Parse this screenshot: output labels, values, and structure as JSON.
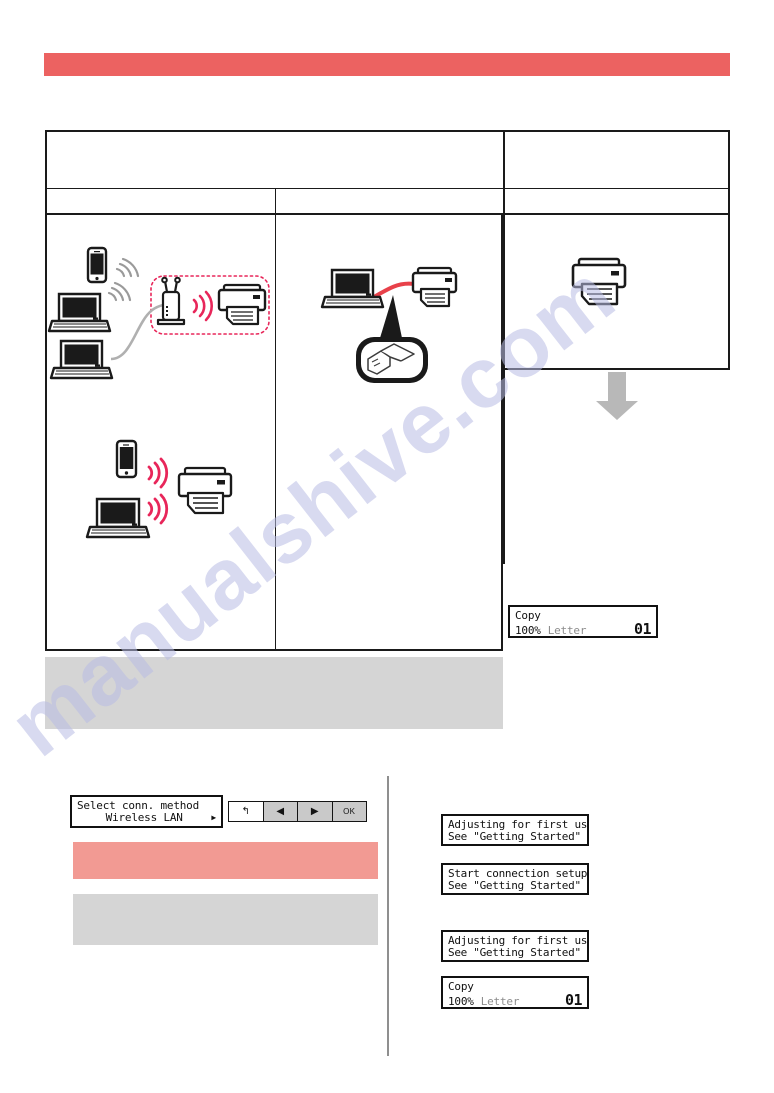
{
  "page": {
    "brand_color": "#ec6261",
    "brand_light_color": "#f29a93",
    "gray_block_color": "#d5d5d5",
    "watermark_text": "manualshive.com"
  },
  "header": {
    "band_label": "",
    "band_color": "#ec6261"
  },
  "method_table": {
    "title_row_label": "",
    "columns": [
      {
        "name": "wireless-lan",
        "header": ""
      },
      {
        "name": "usb",
        "header": ""
      },
      {
        "name": "printer-only",
        "header": ""
      }
    ]
  },
  "diagrams": {
    "wireless_lan": {
      "name": "wireless-lan-diagram",
      "devices": [
        "smartphone",
        "laptop",
        "laptop",
        "router",
        "printer"
      ],
      "highlight_box_color": "#e8265a"
    },
    "wireless_direct": {
      "name": "wireless-direct-diagram",
      "devices": [
        "smartphone",
        "laptop",
        "printer"
      ],
      "signal_color": "#e8265a"
    },
    "usb": {
      "name": "usb-connection-diagram",
      "devices": [
        "laptop",
        "printer",
        "usb-connector"
      ],
      "cable_color": "#e8414a"
    },
    "printer_only": {
      "name": "printer-only-diagram",
      "devices": [
        "printer"
      ]
    }
  },
  "flow": {
    "arrow_color": "#b8b8b8",
    "arrow_direction": "down"
  },
  "lcd_screens": {
    "copy_main": {
      "name": "lcd-copy-screen",
      "line1": "Copy",
      "zoom": "100%",
      "paper": "Letter",
      "count": "01"
    },
    "copy_bottom": {
      "name": "lcd-copy-screen",
      "line1": "Copy",
      "zoom": "100%",
      "paper": "Letter",
      "count": "01"
    },
    "adjusting_1": {
      "line1": "Adjusting for first use…",
      "line2": "See \"Getting Started\" and"
    },
    "start_connection": {
      "line1": "Start connection setup",
      "line2": "See \"Getting Started\""
    },
    "adjusting_2": {
      "line1": "Adjusting for first use…",
      "line2": "See \"Getting Started\" and"
    },
    "select_method": {
      "line1": "Select conn. method",
      "value": "Wireless LAN",
      "caret": "▶"
    }
  },
  "button_strip": {
    "buttons": [
      {
        "name": "back-button",
        "glyph": "↰",
        "label": ""
      },
      {
        "name": "left-arrow-button",
        "glyph": "◀",
        "label": ""
      },
      {
        "name": "right-arrow-button",
        "glyph": "▶",
        "label": ""
      },
      {
        "name": "ok-button",
        "glyph": "",
        "label": "OK"
      }
    ]
  },
  "note_blocks": {
    "gray_note": {
      "text": ""
    },
    "pink_step": {
      "text": ""
    },
    "gray_step": {
      "text": ""
    }
  }
}
